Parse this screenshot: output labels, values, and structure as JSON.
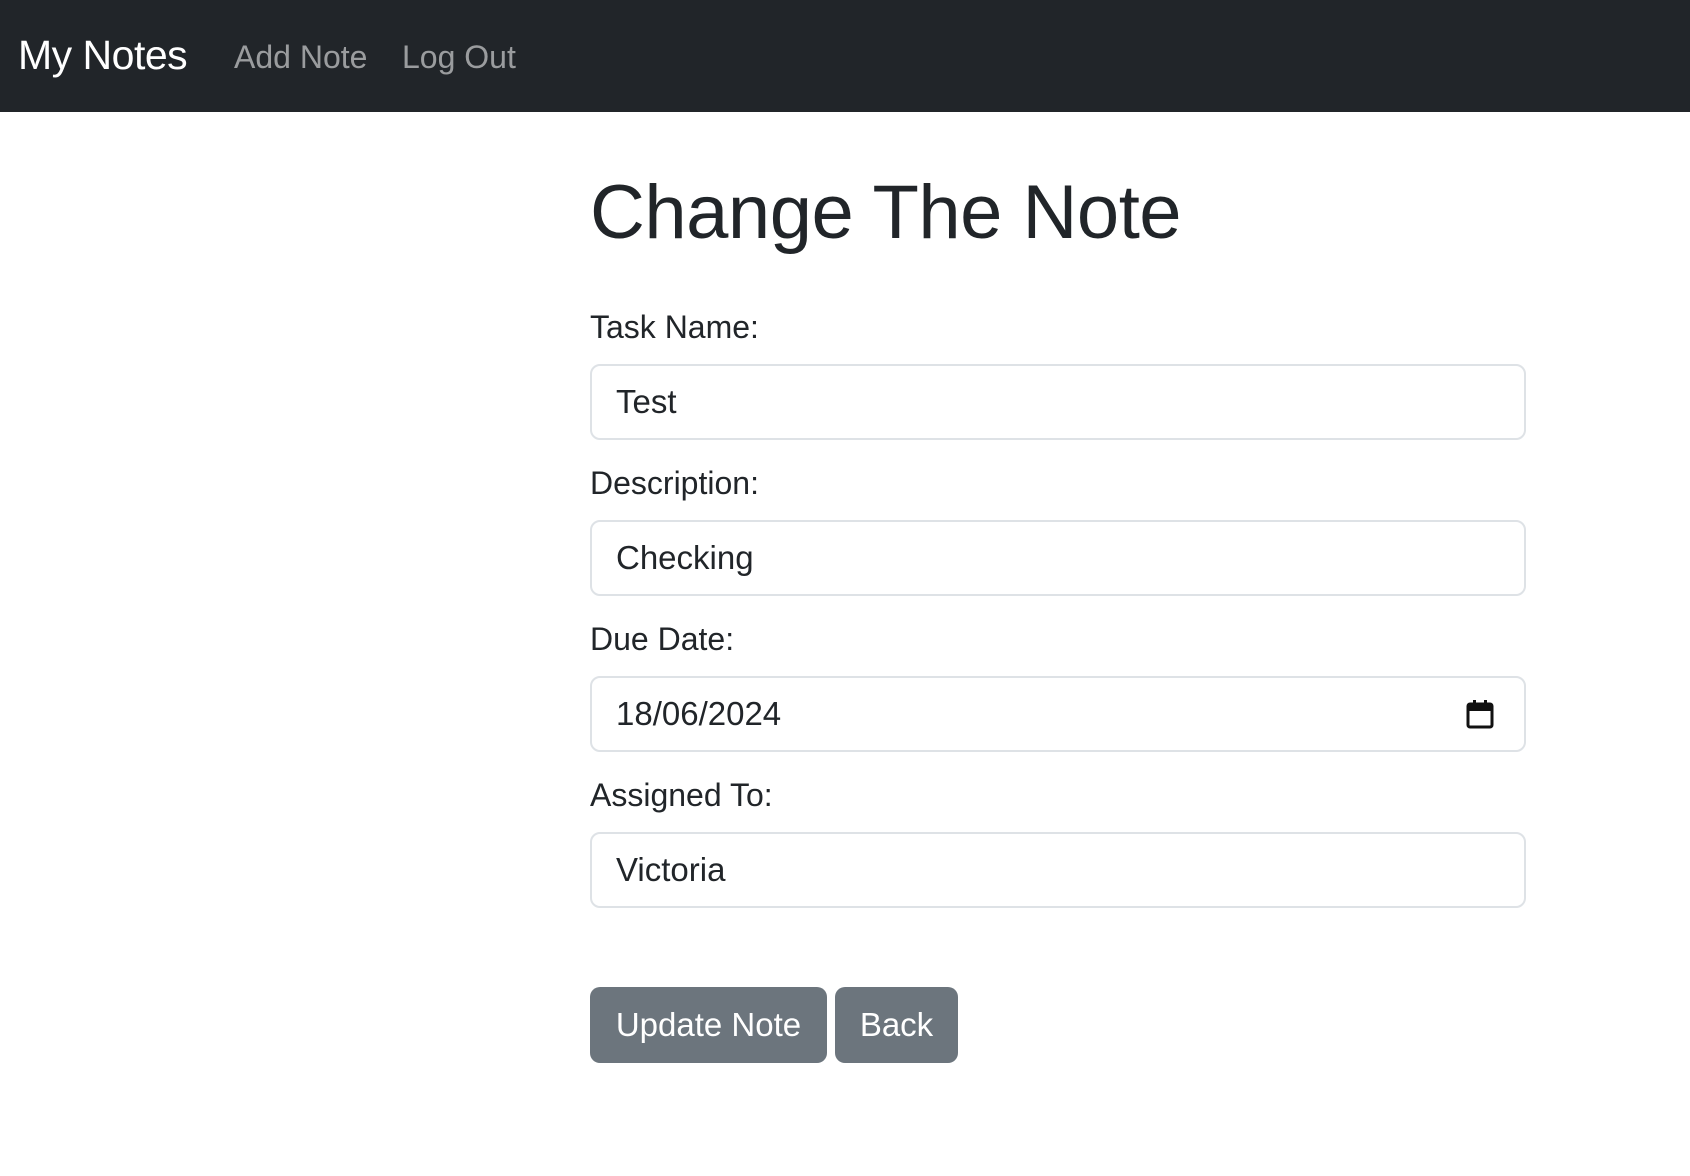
{
  "navbar": {
    "brand": "My Notes",
    "links": [
      {
        "label": "Add Note"
      },
      {
        "label": "Log Out"
      }
    ]
  },
  "page": {
    "title": "Change The Note"
  },
  "form": {
    "task_name": {
      "label": "Task Name:",
      "value": "Test"
    },
    "description": {
      "label": "Description:",
      "value": "Checking"
    },
    "due_date": {
      "label": "Due Date:",
      "value": "18/06/2024",
      "icon": "calendar-icon"
    },
    "assigned_to": {
      "label": "Assigned To:",
      "value": "Victoria"
    }
  },
  "actions": {
    "update_label": "Update Note",
    "back_label": "Back",
    "button_color": "#6c757d"
  },
  "colors": {
    "navbar_bg": "#212529",
    "text": "#212529",
    "input_border": "#dee2e6"
  }
}
